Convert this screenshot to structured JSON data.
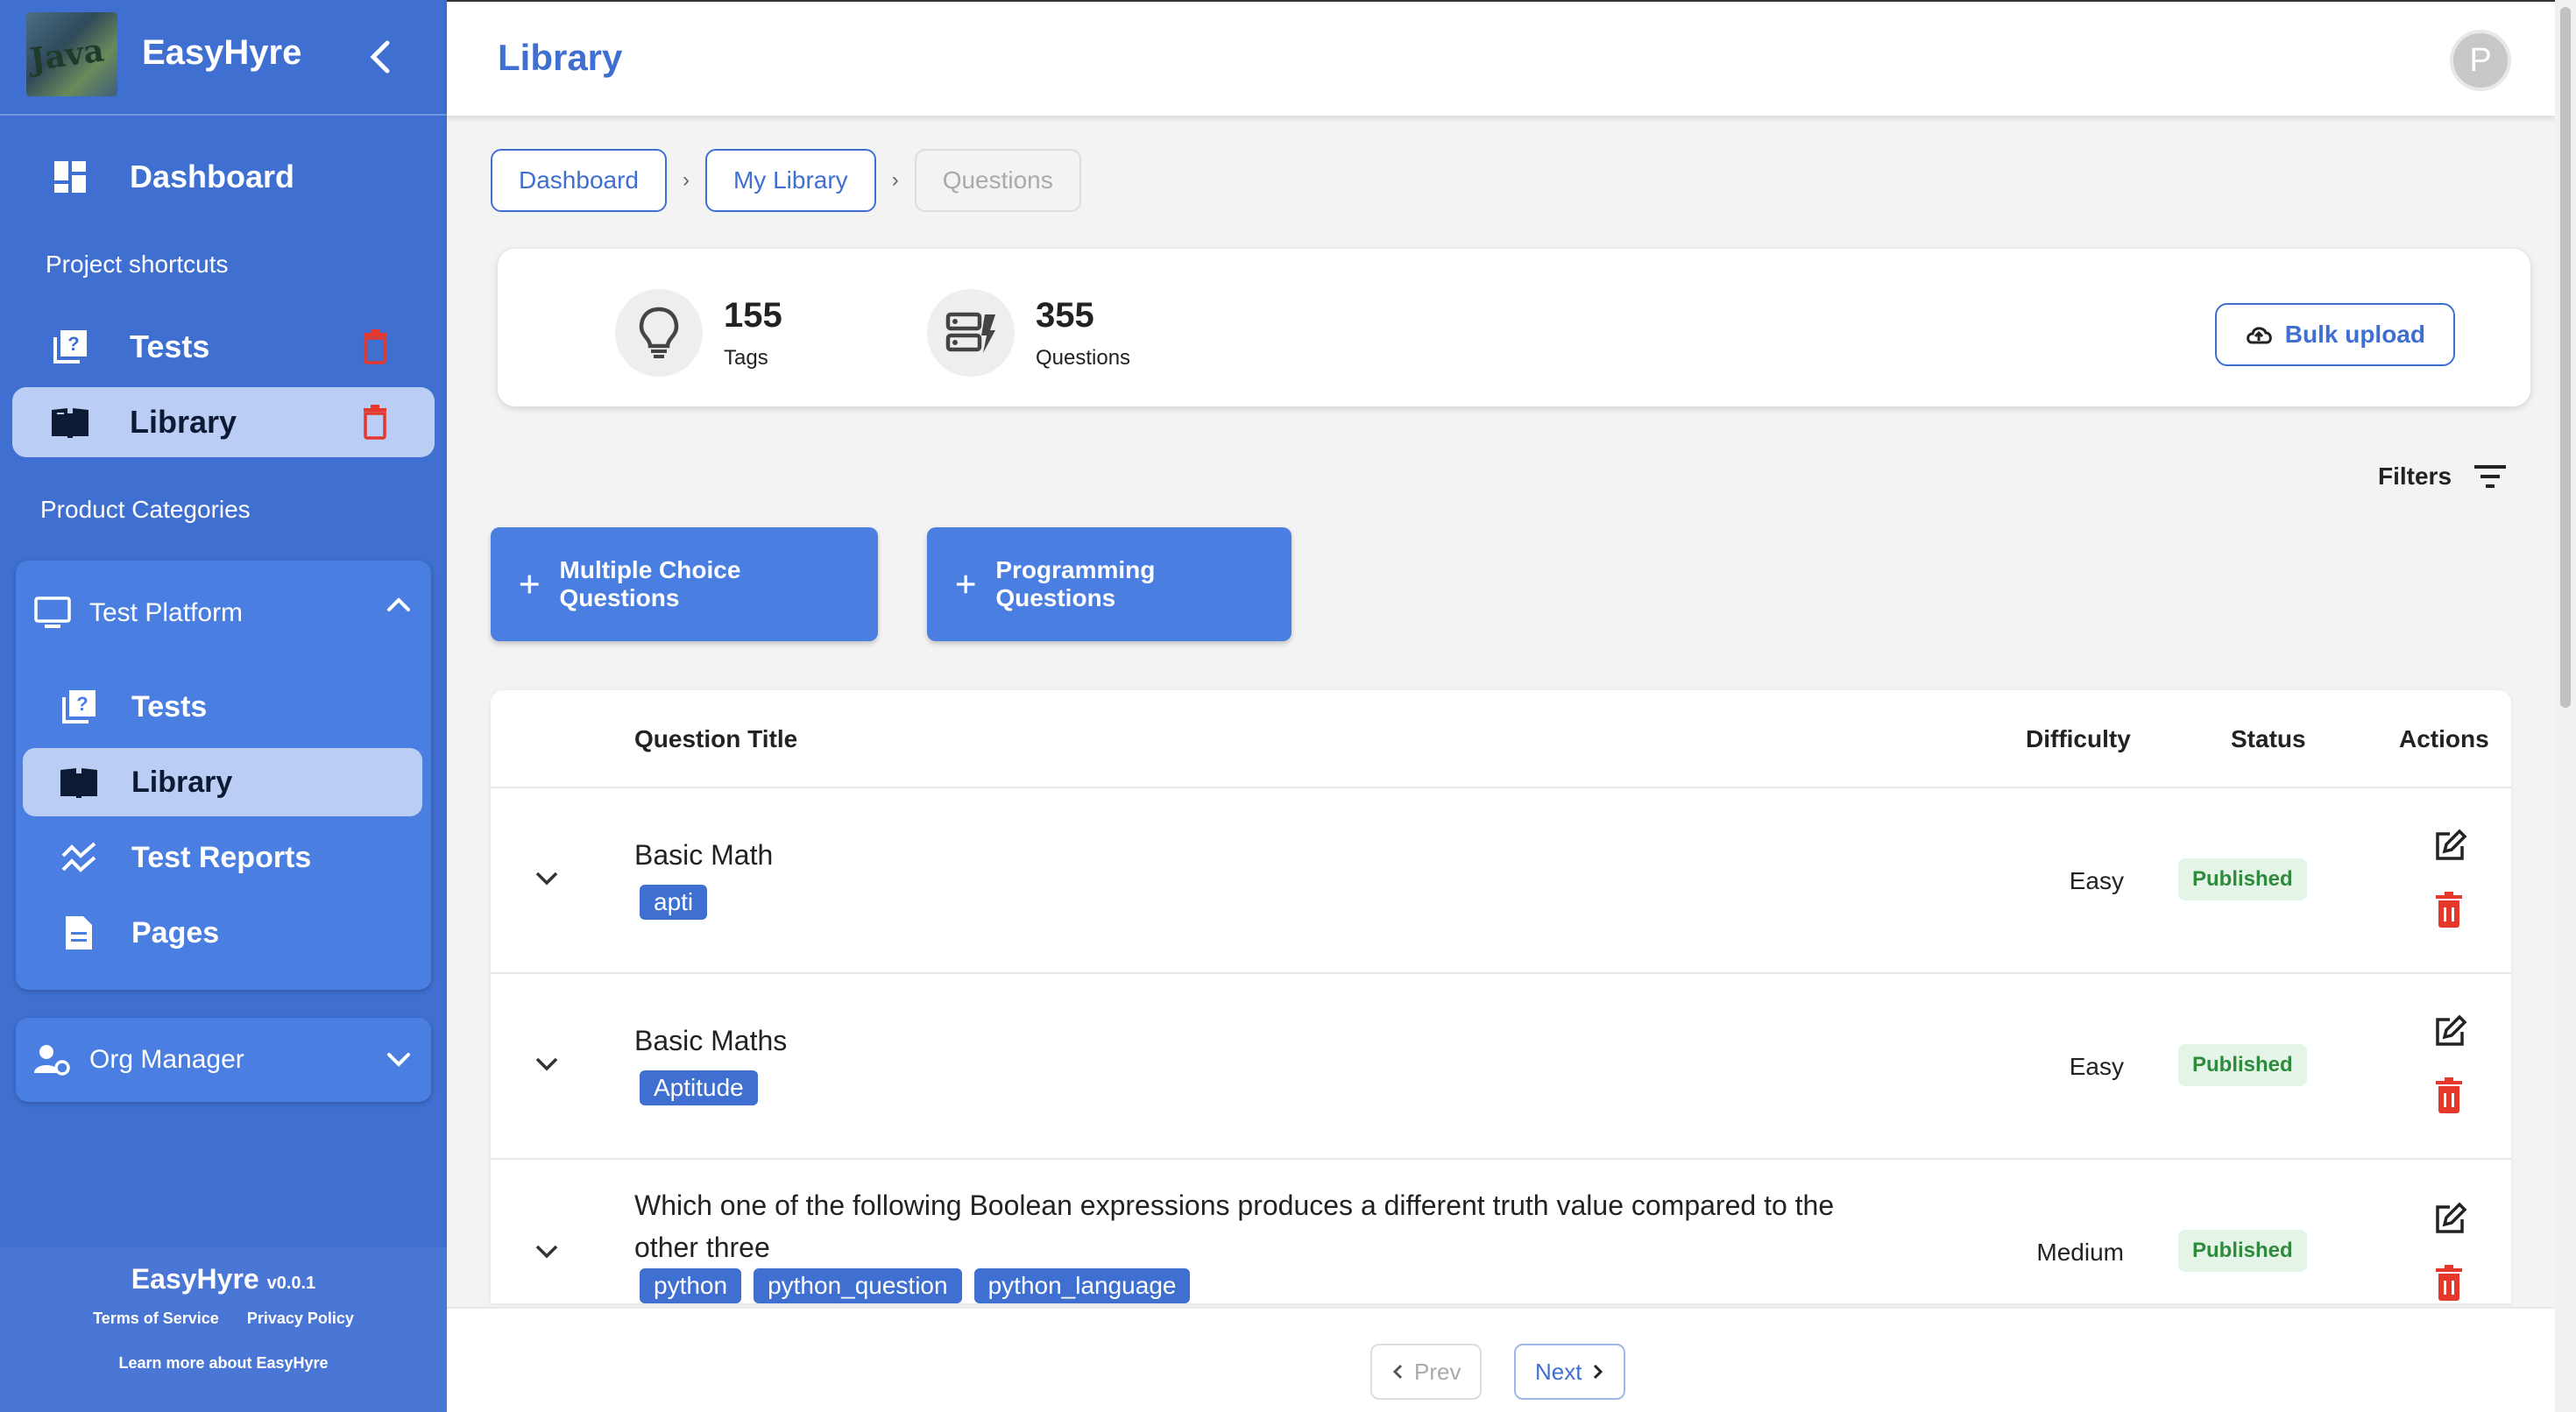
{
  "brand": {
    "name": "EasyHyre",
    "logo_text": "Java"
  },
  "sidebar": {
    "dashboard_label": "Dashboard",
    "project_shortcuts_label": "Project shortcuts",
    "shortcuts": [
      {
        "label": "Tests"
      },
      {
        "label": "Library"
      }
    ],
    "product_categories_label": "Product Categories",
    "test_platform": {
      "label": "Test Platform",
      "items": [
        {
          "label": "Tests"
        },
        {
          "label": "Library"
        },
        {
          "label": "Test Reports"
        },
        {
          "label": "Pages"
        }
      ]
    },
    "org_manager_label": "Org Manager",
    "footer": {
      "name": "EasyHyre",
      "version": "v0.0.1",
      "terms": "Terms of Service",
      "privacy": "Privacy Policy",
      "learn_more": "Learn more about EasyHyre"
    }
  },
  "header": {
    "title": "Library",
    "avatar_letter": "P"
  },
  "breadcrumbs": [
    "Dashboard",
    "My Library",
    "Questions"
  ],
  "stats": {
    "tags_count": "155",
    "tags_label": "Tags",
    "questions_count": "355",
    "questions_label": "Questions",
    "bulk_upload_label": "Bulk upload"
  },
  "filters_label": "Filters",
  "actions": {
    "mcq_label": "Multiple Choice Questions",
    "programming_label": "Programming Questions"
  },
  "table": {
    "columns": {
      "title": "Question Title",
      "difficulty": "Difficulty",
      "status": "Status",
      "actions": "Actions"
    },
    "rows": [
      {
        "title": "Basic Math",
        "tags": [
          "apti"
        ],
        "difficulty": "Easy",
        "status": "Published"
      },
      {
        "title": "Basic Maths",
        "tags": [
          "Aptitude"
        ],
        "difficulty": "Easy",
        "status": "Published"
      },
      {
        "title": "Which one of the following Boolean expressions produces a different truth value compared to the other three",
        "tags": [
          "python",
          "python_question",
          "python_language"
        ],
        "difficulty": "Medium",
        "status": "Published"
      }
    ]
  },
  "pagination": {
    "prev_label": "Prev",
    "next_label": "Next"
  },
  "colors": {
    "primary": "#3f6fd0",
    "sidebar": "#3f6fd0",
    "danger": "#e5372b",
    "success_bg": "#e4f4e6",
    "success_text": "#2e8b3d"
  }
}
